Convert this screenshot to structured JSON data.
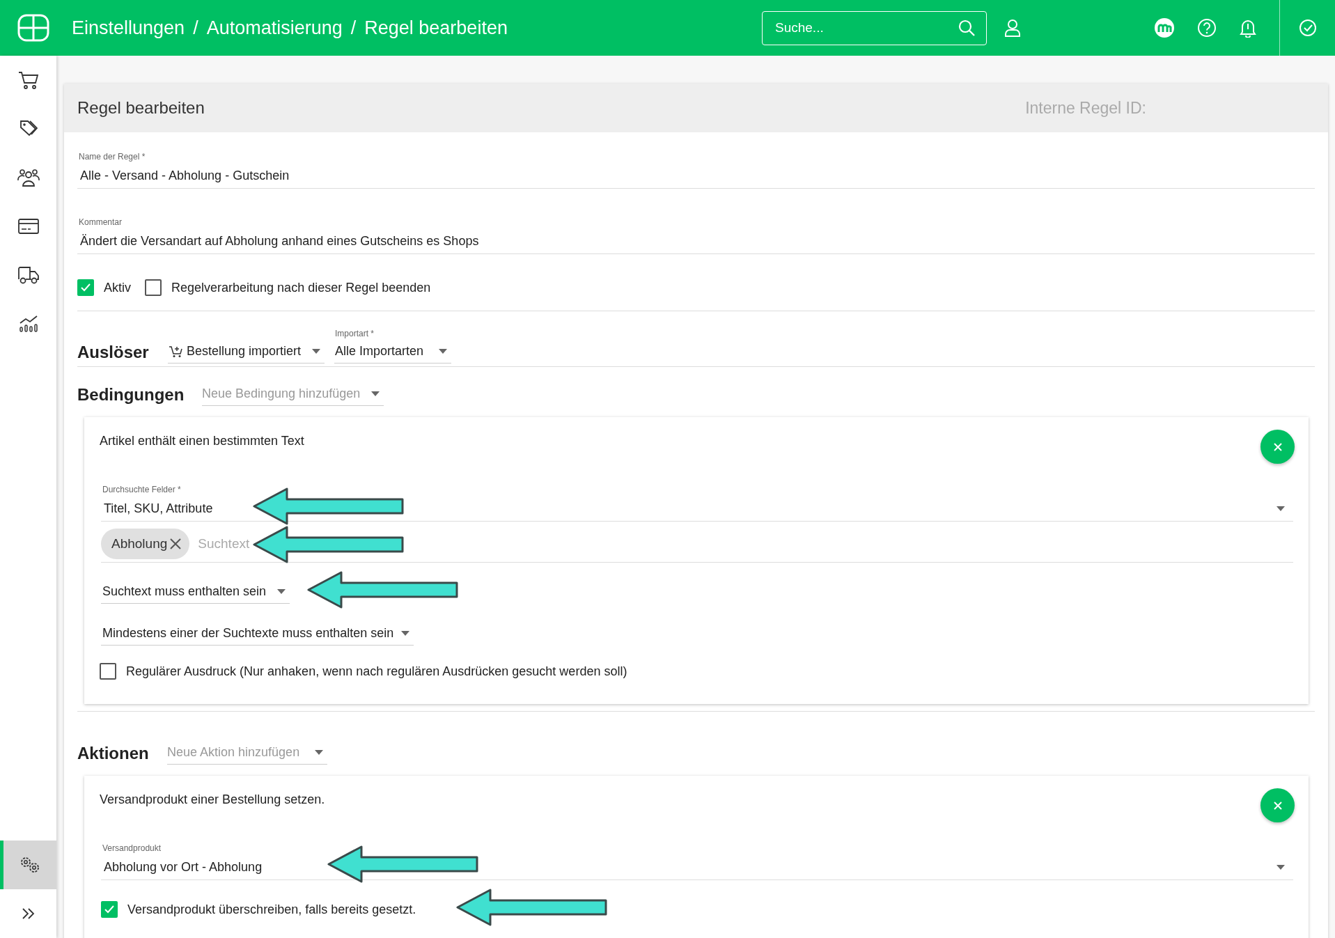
{
  "header": {
    "breadcrumb": [
      "Einstellungen",
      "Automatisierung",
      "Regel bearbeiten"
    ],
    "separator": "/",
    "search": {
      "placeholder": "Suche..."
    }
  },
  "sidebar": {
    "items": [
      {
        "kind": "cart",
        "selected": false
      },
      {
        "kind": "tag",
        "selected": false
      },
      {
        "kind": "people",
        "selected": false
      },
      {
        "kind": "card",
        "selected": false
      },
      {
        "kind": "truck",
        "selected": false
      },
      {
        "kind": "chart",
        "selected": false
      }
    ],
    "bottom": [
      {
        "kind": "settings",
        "selected": true
      },
      {
        "kind": "expand",
        "selected": false
      }
    ]
  },
  "card": {
    "title": "Regel bearbeiten",
    "id_label": "Interne Regel ID:"
  },
  "fields": [
    {
      "label": "Name der Regel *",
      "value": "Alle - Versand - Abholung - Gutschein"
    },
    {
      "label": "Kommentar",
      "value": "Ändert die Versandart auf Abholung anhand eines Gutscheins es Shops"
    }
  ],
  "options": [
    {
      "label": "Aktiv",
      "checked": true
    },
    {
      "label": "Regelverarbeitung nach dieser Regel beenden",
      "checked": false
    }
  ],
  "trigger": {
    "heading": "Auslöser",
    "event": "Bestellung importiert",
    "import_type": {
      "label": "Importart *",
      "value": "Alle Importarten"
    }
  },
  "conditions": {
    "heading": "Bedingungen",
    "add_placeholder": "Neue Bedingung hinzufügen",
    "items": [
      {
        "title": "Artikel enthält einen bestimmten Text",
        "fields_label": "Durchsuchte Felder *",
        "fields_value": "Titel, SKU, Attribute",
        "chips": [
          "Abholung"
        ],
        "search_placeholder": "Suchtext",
        "mode": "Suchtext muss enthalten sein",
        "match": "Mindestens einer der Suchtexte muss enthalten sein",
        "regex": {
          "label": "Regulärer Ausdruck (Nur anhaken, wenn nach regulären Ausdrücken gesucht werden soll)",
          "checked": false
        }
      }
    ]
  },
  "actions": {
    "heading": "Aktionen",
    "add_placeholder": "Neue Aktion hinzufügen",
    "items": [
      {
        "title": "Versandprodukt einer Bestellung setzen.",
        "field_label": "Versandprodukt",
        "field_value": "Abholung vor Ort - Abholung",
        "overwrite": {
          "label": "Versandprodukt überschreiben, falls bereits gesetzt.",
          "checked": true
        }
      }
    ]
  }
}
